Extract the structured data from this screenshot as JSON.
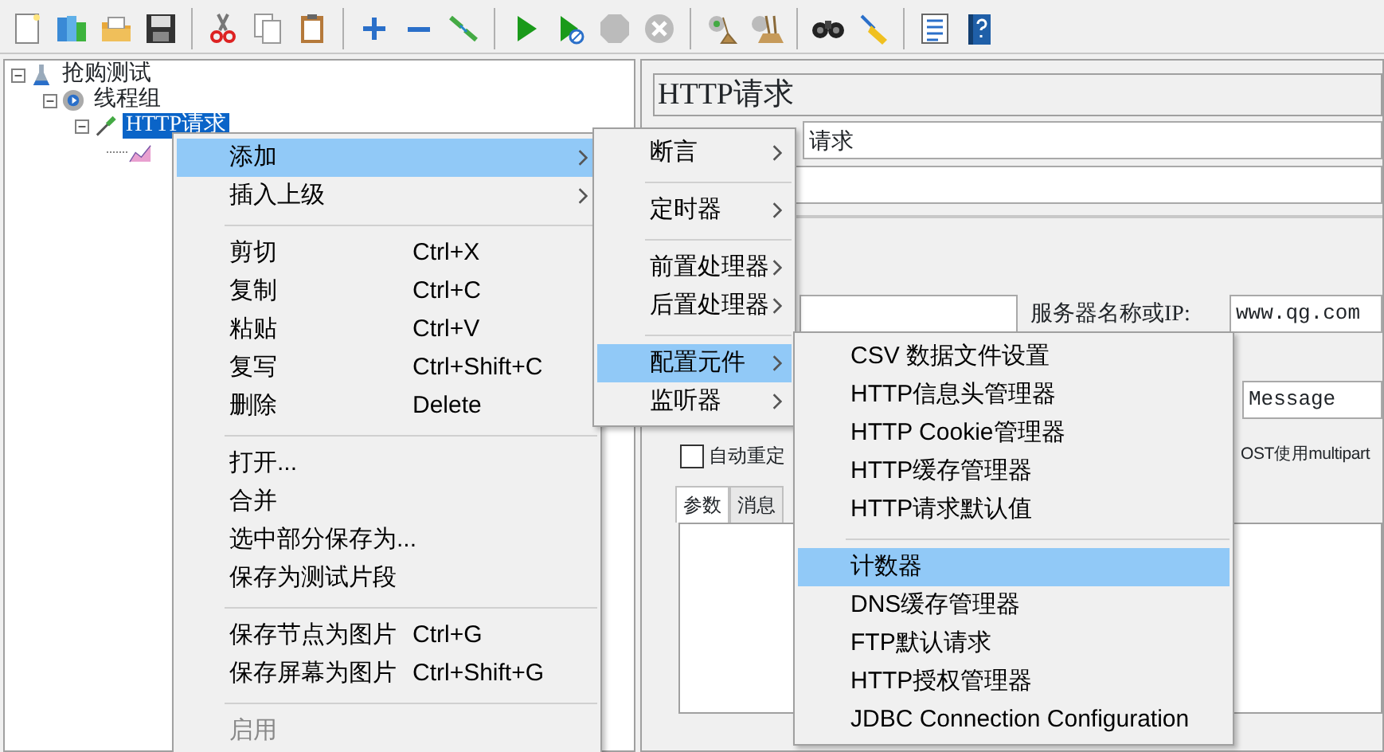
{
  "tree": [
    {
      "label": "抢购测试",
      "kind": "plan",
      "expanded": true,
      "selected": false,
      "children": [
        {
          "label": "线程组",
          "kind": "thread_group",
          "expanded": true,
          "selected": false,
          "children": [
            {
              "label": "HTTP请求",
              "kind": "sampler",
              "expanded": true,
              "selected": true,
              "children": [
                {
                  "kind": "listener",
                  "selected": false
                }
              ]
            }
          ]
        }
      ]
    }
  ],
  "panel": {
    "title": "HTTP请求",
    "name_value": "请求",
    "server_label": "服务器名称或IP:",
    "server_value": "www.qg.com",
    "path_value": "Message",
    "redirect_checkbox": {
      "label": "自动重定",
      "checked": false
    },
    "multipart_label": "OST使用multipart",
    "tabs": [
      {
        "label": "参数",
        "selected": true
      },
      {
        "label": "消息",
        "selected": false
      }
    ]
  },
  "context_menu": [
    {
      "kind": "item",
      "label": "添加",
      "submenu": true,
      "selected": true,
      "disabled": false
    },
    {
      "kind": "item",
      "label": "插入上级",
      "submenu": true,
      "selected": false,
      "disabled": false
    },
    {
      "kind": "separator"
    },
    {
      "kind": "item",
      "label": "剪切",
      "shortcut": "Ctrl+X",
      "submenu": false,
      "selected": false,
      "disabled": false
    },
    {
      "kind": "item",
      "label": "复制",
      "shortcut": "Ctrl+C",
      "submenu": false,
      "selected": false,
      "disabled": false
    },
    {
      "kind": "item",
      "label": "粘贴",
      "shortcut": "Ctrl+V",
      "submenu": false,
      "selected": false,
      "disabled": false
    },
    {
      "kind": "item",
      "label": "复写",
      "shortcut": "Ctrl+Shift+C",
      "submenu": false,
      "selected": false,
      "disabled": false
    },
    {
      "kind": "item",
      "label": "删除",
      "shortcut": "Delete",
      "submenu": false,
      "selected": false,
      "disabled": false
    },
    {
      "kind": "separator"
    },
    {
      "kind": "item",
      "label": "打开...",
      "submenu": false,
      "selected": false,
      "disabled": false
    },
    {
      "kind": "item",
      "label": "合并",
      "submenu": false,
      "selected": false,
      "disabled": false
    },
    {
      "kind": "item",
      "label": "选中部分保存为...",
      "submenu": false,
      "selected": false,
      "disabled": false
    },
    {
      "kind": "item",
      "label": "保存为测试片段",
      "submenu": false,
      "selected": false,
      "disabled": false
    },
    {
      "kind": "separator"
    },
    {
      "kind": "item",
      "label": "保存节点为图片",
      "shortcut": "Ctrl+G",
      "submenu": false,
      "selected": false,
      "disabled": false
    },
    {
      "kind": "item",
      "label": "保存屏幕为图片",
      "shortcut": "Ctrl+Shift+G",
      "submenu": false,
      "selected": false,
      "disabled": false
    },
    {
      "kind": "separator"
    },
    {
      "kind": "item",
      "label": "启用",
      "submenu": false,
      "selected": false,
      "disabled": true
    }
  ],
  "add_submenu": [
    {
      "kind": "item",
      "label": "断言",
      "submenu": true,
      "selected": false,
      "disabled": false
    },
    {
      "kind": "separator"
    },
    {
      "kind": "item",
      "label": "定时器",
      "submenu": true,
      "selected": false,
      "disabled": false
    },
    {
      "kind": "separator"
    },
    {
      "kind": "item",
      "label": "前置处理器",
      "submenu": true,
      "selected": false,
      "disabled": false
    },
    {
      "kind": "item",
      "label": "后置处理器",
      "submenu": true,
      "selected": false,
      "disabled": false
    },
    {
      "kind": "separator"
    },
    {
      "kind": "item",
      "label": "配置元件",
      "submenu": true,
      "selected": true,
      "disabled": false
    },
    {
      "kind": "item",
      "label": "监听器",
      "submenu": true,
      "selected": false,
      "disabled": false
    }
  ],
  "config_submenu": [
    {
      "kind": "item",
      "label": "CSV 数据文件设置",
      "submenu": false,
      "selected": false,
      "disabled": false
    },
    {
      "kind": "item",
      "label": "HTTP信息头管理器",
      "submenu": false,
      "selected": false,
      "disabled": false
    },
    {
      "kind": "item",
      "label": "HTTP Cookie管理器",
      "submenu": false,
      "selected": false,
      "disabled": false
    },
    {
      "kind": "item",
      "label": "HTTP缓存管理器",
      "submenu": false,
      "selected": false,
      "disabled": false
    },
    {
      "kind": "item",
      "label": "HTTP请求默认值",
      "submenu": false,
      "selected": false,
      "disabled": false
    },
    {
      "kind": "separator"
    },
    {
      "kind": "item",
      "label": "计数器",
      "submenu": false,
      "selected": true,
      "disabled": false
    },
    {
      "kind": "item",
      "label": "DNS缓存管理器",
      "submenu": false,
      "selected": false,
      "disabled": false
    },
    {
      "kind": "item",
      "label": "FTP默认请求",
      "submenu": false,
      "selected": false,
      "disabled": false
    },
    {
      "kind": "item",
      "label": "HTTP授权管理器",
      "submenu": false,
      "selected": false,
      "disabled": false
    },
    {
      "kind": "item",
      "label": "JDBC Connection Configuration",
      "submenu": false,
      "selected": false,
      "disabled": false
    }
  ]
}
